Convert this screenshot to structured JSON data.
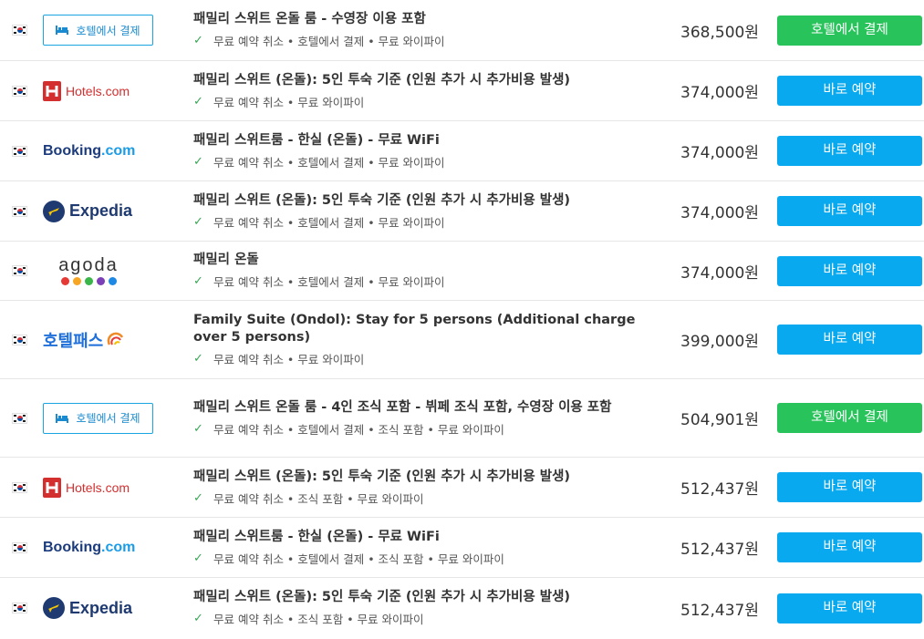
{
  "common": {
    "price_unit": "원"
  },
  "colors": {
    "book_button": "#08a9ef",
    "pay_button": "#28c35b",
    "check": "#3aa757",
    "hotels_red": "#d32f2f",
    "booking_navy": "#1b3b7d",
    "booking_blue": "#1a9ce8",
    "expedia_navy": "#1e3a70",
    "hotelpass_blue": "#1e6fd9",
    "agoda_dots": [
      "#e53935",
      "#f6a623",
      "#39b54a",
      "#7b3fb7",
      "#1e88e5"
    ]
  },
  "rows": [
    {
      "provider": "hotel-direct",
      "provider_label": "호텔에서 결제",
      "title": "패밀리 스위트 온돌 룸 - 수영장 이용 포함",
      "features": "무료 예약 취소 • 호텔에서 결제 • 무료 와이파이",
      "price": "368,500",
      "button": "호텔에서 결제",
      "button_style": "green"
    },
    {
      "provider": "hotels-com",
      "provider_label": "Hotels.com",
      "title": "패밀리 스위트 (온돌): 5인 투숙 기준 (인원 추가 시 추가비용 발생)",
      "features": "무료 예약 취소 • 무료 와이파이",
      "price": "374,000",
      "button": "바로 예약",
      "button_style": "blue"
    },
    {
      "provider": "booking-com",
      "provider_label": "Booking",
      "provider_label_suffix": ".com",
      "title": "패밀리 스위트룸 - 한실 (온돌) - 무료 WiFi",
      "features": "무료 예약 취소 • 호텔에서 결제 • 무료 와이파이",
      "price": "374,000",
      "button": "바로 예약",
      "button_style": "blue"
    },
    {
      "provider": "expedia",
      "provider_label": "Expedia",
      "title": "패밀리 스위트 (온돌): 5인 투숙 기준 (인원 추가 시 추가비용 발생)",
      "features": "무료 예약 취소 • 호텔에서 결제 • 무료 와이파이",
      "price": "374,000",
      "button": "바로 예약",
      "button_style": "blue"
    },
    {
      "provider": "agoda",
      "provider_label": "agoda",
      "title": "패밀리 온돌",
      "features": "무료 예약 취소 • 호텔에서 결제 • 무료 와이파이",
      "price": "374,000",
      "button": "바로 예약",
      "button_style": "blue"
    },
    {
      "provider": "hotelpass",
      "provider_label": "호텔패스",
      "title": "Family Suite (Ondol): Stay for 5 persons (Additional charge over 5 persons)",
      "features": "무료 예약 취소 • 무료 와이파이",
      "price": "399,000",
      "button": "바로 예약",
      "button_style": "blue"
    },
    {
      "provider": "hotel-direct",
      "provider_label": "호텔에서 결제",
      "title": "패밀리 스위트 온돌 룸 - 4인 조식 포함 - 뷔페 조식 포함, 수영장 이용 포함",
      "features": "무료 예약 취소 • 호텔에서 결제 • 조식 포함 • 무료 와이파이",
      "price": "504,901",
      "button": "호텔에서 결제",
      "button_style": "green"
    },
    {
      "provider": "hotels-com",
      "provider_label": "Hotels.com",
      "title": "패밀리 스위트 (온돌): 5인 투숙 기준 (인원 추가 시 추가비용 발생)",
      "features": "무료 예약 취소 • 조식 포함 • 무료 와이파이",
      "price": "512,437",
      "button": "바로 예약",
      "button_style": "blue"
    },
    {
      "provider": "booking-com",
      "provider_label": "Booking",
      "provider_label_suffix": ".com",
      "title": "패밀리 스위트룸 - 한실 (온돌) - 무료 WiFi",
      "features": "무료 예약 취소 • 호텔에서 결제 • 조식 포함 • 무료 와이파이",
      "price": "512,437",
      "button": "바로 예약",
      "button_style": "blue"
    },
    {
      "provider": "expedia",
      "provider_label": "Expedia",
      "title": "패밀리 스위트 (온돌): 5인 투숙 기준 (인원 추가 시 추가비용 발생)",
      "features": "무료 예약 취소 • 조식 포함 • 무료 와이파이",
      "price": "512,437",
      "button": "바로 예약",
      "button_style": "blue"
    }
  ]
}
